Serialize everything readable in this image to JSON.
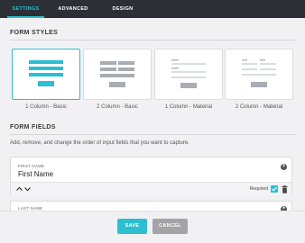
{
  "tabs": [
    {
      "label": "SETTINGS",
      "active": true
    },
    {
      "label": "ADVANCED",
      "active": false
    },
    {
      "label": "DESIGN",
      "active": false
    }
  ],
  "form_styles": {
    "title": "FORM STYLES",
    "options": [
      {
        "label": "1 Column - Basic",
        "selected": true
      },
      {
        "label": "2 Column - Basic",
        "selected": false
      },
      {
        "label": "1 Column - Material",
        "selected": false
      },
      {
        "label": "2 Column - Material",
        "selected": false
      }
    ]
  },
  "form_fields": {
    "title": "FORM FIELDS",
    "description": "Add, remove, and change the order of input fields that you want to capture.",
    "fields": [
      {
        "small_label": "FIRST NAME",
        "value": "First Name",
        "required_label": "Required",
        "required": true
      },
      {
        "small_label": "LAST NAME"
      }
    ]
  },
  "buttons": {
    "save": "SAVE",
    "cancel": "CANCEL"
  },
  "colors": {
    "accent": "#2bbfd0",
    "tab_bar": "#2c2f36",
    "cancel": "#a3a3a8"
  },
  "icons": {
    "add": "plus-circle-icon",
    "move_up": "chevron-up-icon",
    "move_down": "chevron-down-icon",
    "delete": "trash-icon",
    "check": "check-icon"
  }
}
